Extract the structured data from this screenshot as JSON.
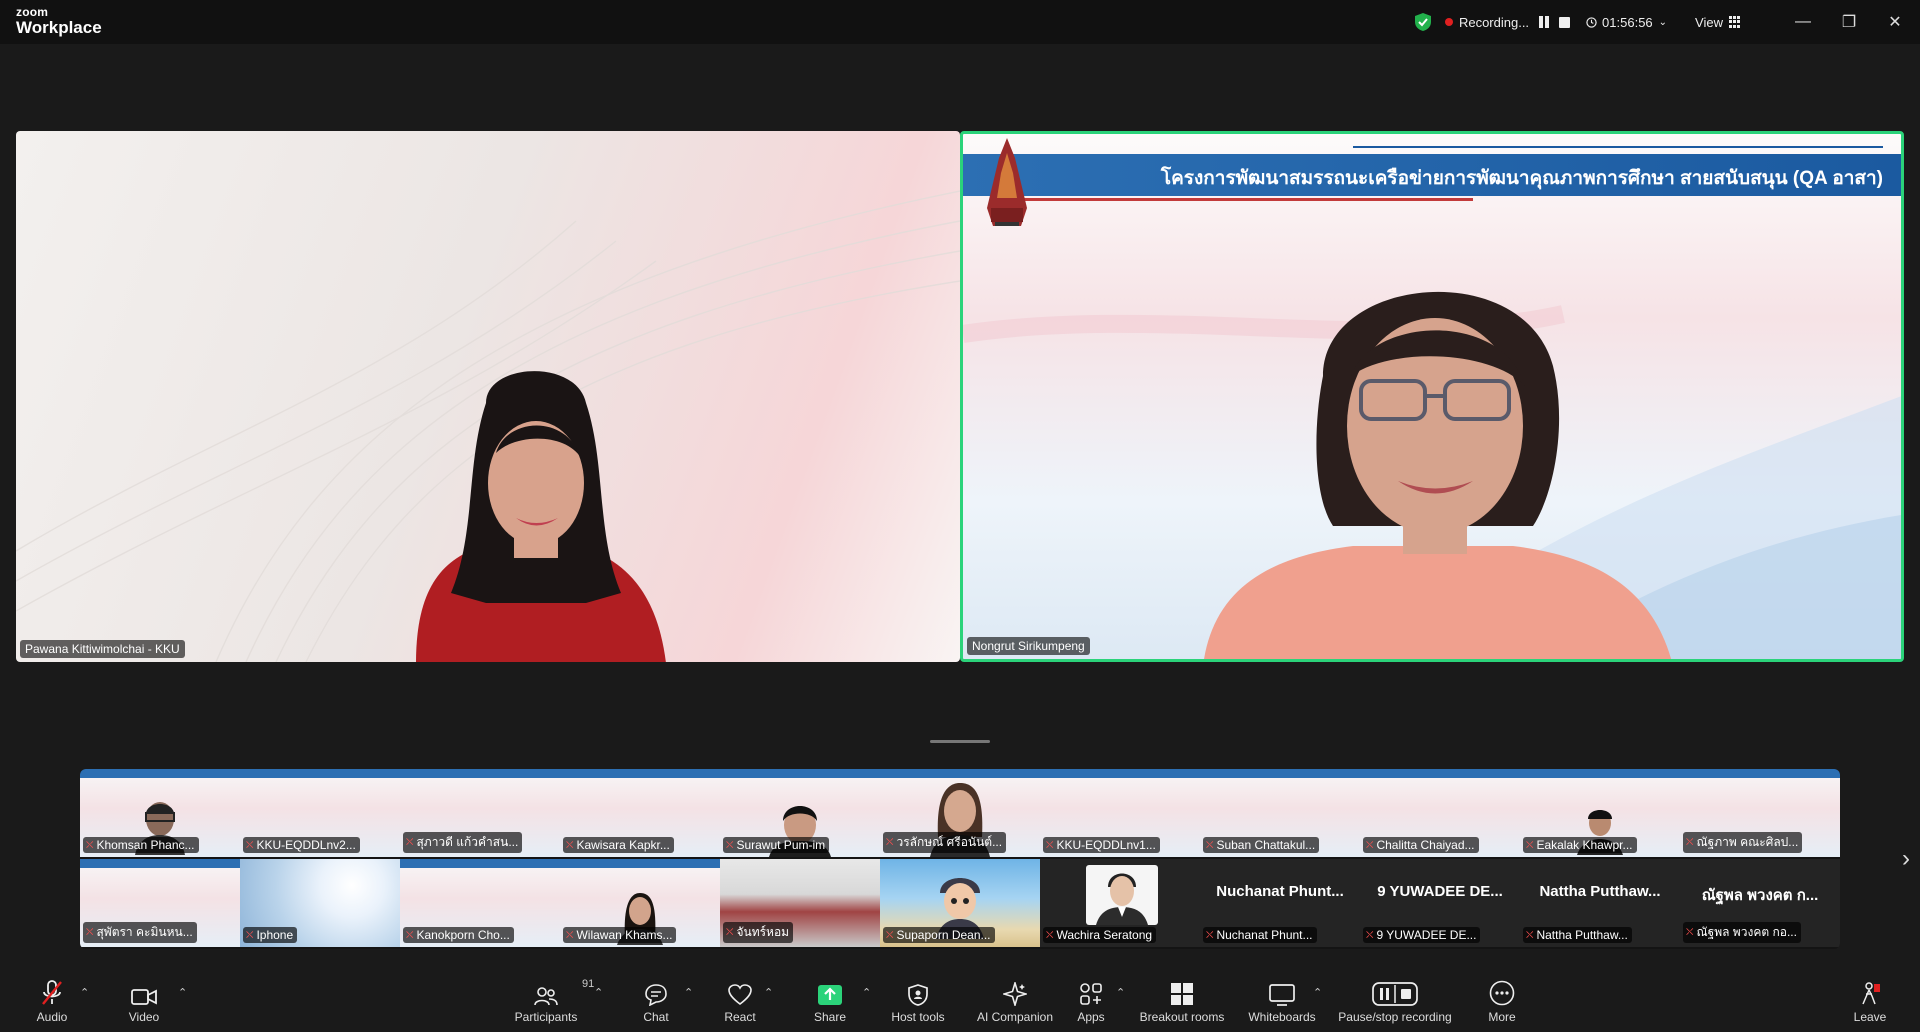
{
  "app": {
    "brand_top": "zoom",
    "brand_bottom": "Workplace"
  },
  "titlebar": {
    "recording_label": "Recording...",
    "timer": "01:56:56",
    "view_label": "View"
  },
  "main_tiles": {
    "left_name": "Pawana Kittiwimolchai - KKU",
    "right_name": "Nongrut Sirikumpeng",
    "slide_title": "โครงการพัฒนาสมรรถนะเครือข่ายการพัฒนาคุณภาพการศึกษา สายสนับสนุน (QA อาสา)"
  },
  "gallery": {
    "row1": [
      {
        "name": "Khomsan Phanc...",
        "bg": "slide"
      },
      {
        "name": "KKU-EQDDLnv2...",
        "bg": "slide"
      },
      {
        "name": "สุภาวดี แก้วคำสน...",
        "bg": "slide"
      },
      {
        "name": "Kawisara Kapkr...",
        "bg": "slide"
      },
      {
        "name": "Surawut Pum-im",
        "bg": "slide"
      },
      {
        "name": "วรลักษณ์ ศรีอนันต์...",
        "bg": "slide"
      },
      {
        "name": "KKU-EQDDLnv1...",
        "bg": "slide"
      },
      {
        "name": "Suban Chattakul...",
        "bg": "slide"
      },
      {
        "name": "Chalitta Chaiyad...",
        "bg": "slide"
      },
      {
        "name": "Eakalak Khawpr...",
        "bg": "slide"
      },
      {
        "name": "ณัฐภาพ คณะศิลป...",
        "bg": "slide"
      }
    ],
    "row2": [
      {
        "name": "สุพัตรา คะมินหน...",
        "bg": "slide"
      },
      {
        "name": "Iphone",
        "bg": "flowers"
      },
      {
        "name": "Kanokporn Cho...",
        "bg": "slide"
      },
      {
        "name": "Wilawan Khams...",
        "bg": "slide"
      },
      {
        "name": "จันทร์หอม",
        "bg": "lobby"
      },
      {
        "name": "Supaporn Dean...",
        "bg": "beach"
      },
      {
        "name": "Wachira Seratong",
        "bg": "avatar"
      },
      {
        "name": "Nuchanat Phunt...",
        "big": "Nuchanat Phunt...",
        "bg": "dark"
      },
      {
        "name": "9 YUWADEE DE...",
        "big": "9 YUWADEE DE...",
        "bg": "dark"
      },
      {
        "name": "Nattha Putthaw...",
        "big": "Nattha Putthaw...",
        "bg": "dark"
      },
      {
        "name": "ณัฐพล พวงคต กอ...",
        "big": "ณัฐพล พวงคต ก...",
        "bg": "dark"
      }
    ]
  },
  "toolbar": {
    "audio": "Audio",
    "video": "Video",
    "participants": "Participants",
    "participants_count": "91",
    "chat": "Chat",
    "react": "React",
    "share": "Share",
    "host_tools": "Host tools",
    "ai_companion": "AI Companion",
    "apps": "Apps",
    "breakout_rooms": "Breakout rooms",
    "whiteboards": "Whiteboards",
    "pause_stop_recording": "Pause/stop recording",
    "more": "More",
    "leave": "Leave"
  },
  "colors": {
    "active_speaker_border": "#2bd37a",
    "share_green": "#2bd37a",
    "leave_red": "#e02020",
    "recording_red": "#e02020"
  }
}
